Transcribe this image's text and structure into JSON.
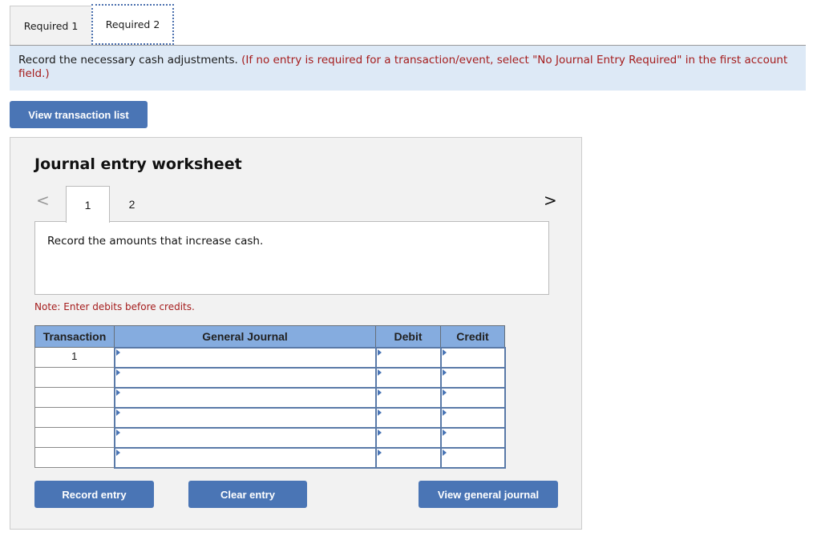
{
  "tabs": [
    {
      "label": "Required 1",
      "active": false
    },
    {
      "label": "Required 2",
      "active": true
    }
  ],
  "banner": {
    "instruction": "Record the necessary cash adjustments.",
    "hint": "(If no entry is required for a transaction/event, select \"No Journal Entry Required\" in the first account field.)"
  },
  "buttons": {
    "view_transaction_list": "View transaction list",
    "record_entry": "Record entry",
    "clear_entry": "Clear entry",
    "view_general_journal": "View general journal"
  },
  "worksheet": {
    "title": "Journal entry worksheet",
    "nav_prev_icon": "chevron-left",
    "nav_next_icon": "chevron-right",
    "prev_glyph": "<",
    "next_glyph": ">",
    "steps": [
      {
        "label": "1",
        "active": true
      },
      {
        "label": "2",
        "active": false
      }
    ],
    "prompt": "Record the amounts that increase cash.",
    "note": "Note: Enter debits before credits."
  },
  "journal_table": {
    "headers": {
      "transaction": "Transaction",
      "general_journal": "General Journal",
      "debit": "Debit",
      "credit": "Credit"
    },
    "rows": [
      {
        "transaction": "1",
        "account": "",
        "debit": "",
        "credit": ""
      },
      {
        "transaction": "",
        "account": "",
        "debit": "",
        "credit": ""
      },
      {
        "transaction": "",
        "account": "",
        "debit": "",
        "credit": ""
      },
      {
        "transaction": "",
        "account": "",
        "debit": "",
        "credit": ""
      },
      {
        "transaction": "",
        "account": "",
        "debit": "",
        "credit": ""
      },
      {
        "transaction": "",
        "account": "",
        "debit": "",
        "credit": ""
      }
    ]
  },
  "colors": {
    "accent_button": "#4a75b5",
    "banner_bg": "#dde9f6",
    "hint_text": "#a51c1c",
    "table_header_bg": "#85acdf",
    "panel_bg": "#f2f2f2"
  }
}
